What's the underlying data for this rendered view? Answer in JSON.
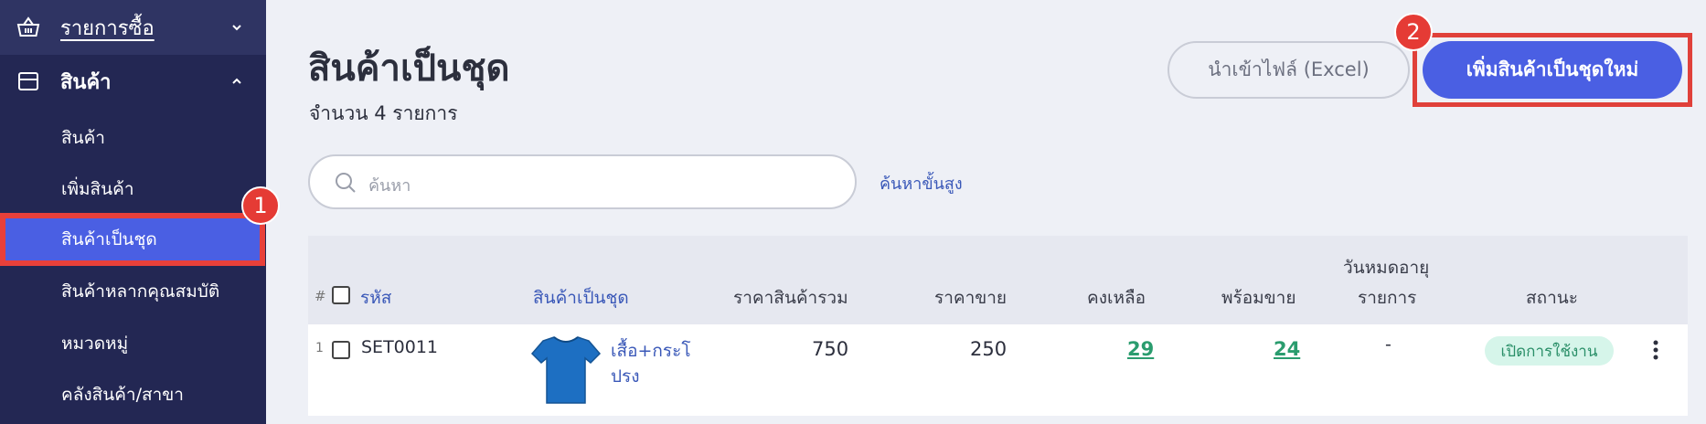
{
  "sidebar": {
    "section_purchases": "รายการซื้อ",
    "section_products": "สินค้า",
    "items": [
      {
        "label": "สินค้า"
      },
      {
        "label": "เพิ่มสินค้า"
      },
      {
        "label": "สินค้าเป็นชุด"
      },
      {
        "label": "สินค้าหลากคุณสมบัติ"
      },
      {
        "label": "หมวดหมู่"
      },
      {
        "label": "คลังสินค้า/สาขา"
      }
    ]
  },
  "badges": {
    "first": "1",
    "second": "2"
  },
  "page": {
    "title": "สินค้าเป็นชุด",
    "count": "จำนวน 4 รายการ",
    "import_button": "นำเข้าไฟล์ (Excel)",
    "add_button": "เพิ่มสินค้าเป็นชุดใหม่"
  },
  "search": {
    "placeholder": "ค้นหา",
    "advanced": "ค้นหาขั้นสูง"
  },
  "table": {
    "headers": {
      "index": "#",
      "code": "รหัส",
      "set_product": "สินค้าเป็นชุด",
      "total_price": "ราคาสินค้ารวม",
      "sale_price": "ราคาขาย",
      "remaining": "คงเหลือ",
      "available": "พร้อมขาย",
      "expiry_line1": "วันหมดอายุ",
      "expiry_line2": "รายการ",
      "status": "สถานะ"
    },
    "rows": [
      {
        "index": "1",
        "code": "SET0011",
        "name_line1": "เสื้อ+กระโ",
        "name_line2": "ปรง",
        "total_price": "750",
        "sale_price": "250",
        "remaining": "29",
        "available": "24",
        "expiry": "-",
        "status": "เปิดการใช้งาน"
      }
    ]
  },
  "colors": {
    "sidebar_bg": "#232753",
    "accent": "#4a5fe3",
    "highlight": "#e53b35",
    "link": "#3a58b8",
    "stock_green": "#2a9c6e"
  }
}
